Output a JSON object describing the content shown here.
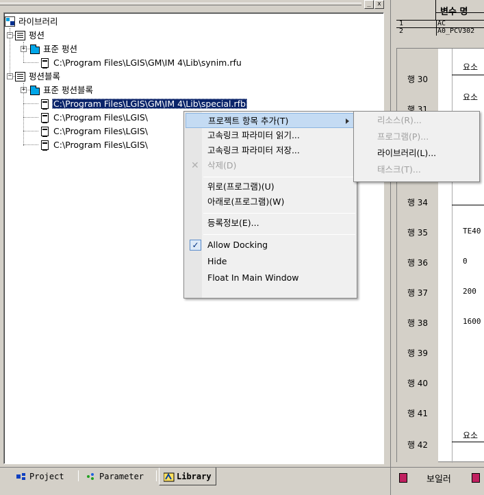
{
  "titlebar": {
    "btn_pin": "_",
    "btn_close": "x"
  },
  "tree": {
    "root": "라이브러리",
    "function_group": "펑션",
    "standard_function": "표준 펑션",
    "function_file": "C:\\Program Files\\LGIS\\GM\\IM 4\\Lib\\synim.rfu",
    "function_block_group": "펑션블록",
    "standard_function_block": "표준 펑션블록",
    "fb_file_1": "C:\\Program Files\\LGIS\\GM\\IM 4\\Lib\\special.rfb",
    "fb_file_2": "C:\\Program Files\\LGIS\\",
    "fb_file_3": "C:\\Program Files\\LGIS\\",
    "fb_file_4": "C:\\Program Files\\LGIS\\",
    "expand_minus": "−",
    "expand_plus": "+"
  },
  "tabs": [
    {
      "label": "Project"
    },
    {
      "label": "Parameter"
    },
    {
      "label": "Library"
    }
  ],
  "context_menu": {
    "items": [
      {
        "label": "프로젝트 항목 추가(T)"
      },
      {
        "label": "고속링크 파라미터 읽기..."
      },
      {
        "label": "고속링크 파라미터 저장..."
      },
      {
        "label": "삭제(D)"
      },
      {
        "label": "위로(프로그램)(U)"
      },
      {
        "label": "아래로(프로그램)(W)"
      },
      {
        "label": "등록정보(E)..."
      },
      {
        "label": "Allow Docking"
      },
      {
        "label": "Hide"
      },
      {
        "label": "Float In Main Window"
      }
    ],
    "check_glyph": "✓",
    "delete_glyph": "✕"
  },
  "submenu": {
    "items": [
      {
        "label": "리소스(R)..."
      },
      {
        "label": "프로그램(P)..."
      },
      {
        "label": "라이브러리(L)..."
      },
      {
        "label": "태스크(T)..."
      }
    ]
  },
  "var_table": {
    "header": "변수 명",
    "rows": [
      {
        "num": "1",
        "name": "AC"
      },
      {
        "num": "2",
        "name": "A0_PCV302"
      }
    ]
  },
  "ladder": {
    "rows": [
      {
        "label": "행 30",
        "value": ""
      },
      {
        "label": "행 31",
        "value": ""
      },
      {
        "label": "행 34",
        "value": ""
      },
      {
        "label": "행 35",
        "value": "TE40"
      },
      {
        "label": "행 36",
        "value": "0"
      },
      {
        "label": "행 37",
        "value": "200"
      },
      {
        "label": "행 38",
        "value": "1600"
      },
      {
        "label": "행 39",
        "value": ""
      },
      {
        "label": "행 40",
        "value": ""
      },
      {
        "label": "행 41",
        "value": ""
      },
      {
        "label": "행 42",
        "value": ""
      }
    ],
    "fragments": {
      "f1": "요소",
      "f2": "요소",
      "f3": "요소"
    }
  },
  "bottom_right": {
    "label": "보일러"
  },
  "colors": {
    "selection": "#0a246a",
    "menu_highlight": "#c4dbf3",
    "folder": "#00a6e8"
  }
}
